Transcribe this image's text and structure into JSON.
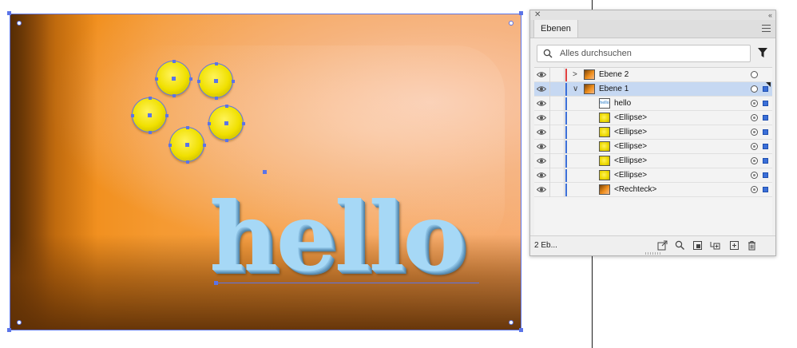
{
  "artwork": {
    "text_object": "hello",
    "colors": {
      "background_orange": "#f08f1c",
      "ellipse_yellow": "#f0e000",
      "text_blue": "#a6d8f6",
      "selection_blue": "#5b74e8"
    }
  },
  "layers_panel": {
    "tab_label": "Ebenen",
    "search": {
      "placeholder": "Alles durchsuchen",
      "value": ""
    },
    "layers": [
      {
        "name": "Ebene 2",
        "expanded": false,
        "color": "#e04040"
      },
      {
        "name": "Ebene 1",
        "expanded": true,
        "color": "#3b6fd8",
        "selected": true
      }
    ],
    "sublayers": [
      {
        "name": "hello",
        "thumb": "text"
      },
      {
        "name": "<Ellipse>",
        "thumb": "yellow"
      },
      {
        "name": "<Ellipse>",
        "thumb": "yellow"
      },
      {
        "name": "<Ellipse>",
        "thumb": "yellow"
      },
      {
        "name": "<Ellipse>",
        "thumb": "yellow"
      },
      {
        "name": "<Ellipse>",
        "thumb": "yellow"
      },
      {
        "name": "<Rechteck>",
        "thumb": "orange"
      }
    ],
    "footer": {
      "layer_count": "2 Eb...",
      "icons": [
        "export-icon",
        "locate-object-icon",
        "clipping-mask-icon",
        "new-sublayer-icon",
        "new-layer-icon",
        "trash-icon"
      ]
    },
    "thumb_text_label": "hello"
  }
}
